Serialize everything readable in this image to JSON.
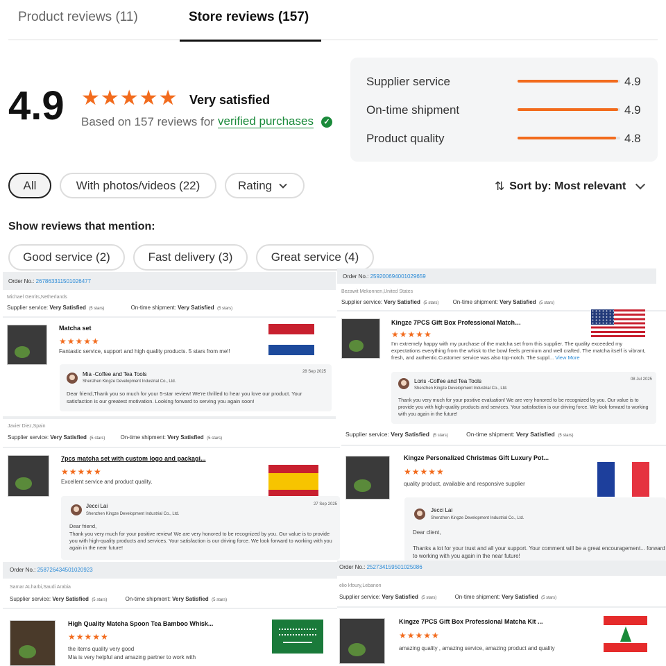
{
  "tabs": [
    {
      "label": "Product reviews (11)"
    },
    {
      "label": "Store reviews (157)"
    }
  ],
  "summary": {
    "score": "4.9",
    "stars": "★★★★★",
    "rating_text": "Very satisfied",
    "based_on": "Based on 157 reviews for",
    "verified_link": "verified purchases",
    "verified_icon": "✓"
  },
  "metrics": [
    {
      "label": "Supplier service",
      "value": "4.9",
      "fill": 0.98
    },
    {
      "label": "On-time shipment",
      "value": "4.9",
      "fill": 0.98
    },
    {
      "label": "Product quality",
      "value": "4.8",
      "fill": 0.96
    }
  ],
  "filters": {
    "all": "All",
    "photos": "With photos/videos (22)",
    "rating": "Rating",
    "sort": "Sort by: Most relevant"
  },
  "mentions": {
    "title": "Show reviews that mention:",
    "tags": [
      "Good service (2)",
      "Fast delivery (3)",
      "Great service (4)"
    ]
  },
  "reviews": [
    {
      "order_label": "Order No.:",
      "order_no": "267863311501026477",
      "reviewer": "Michael Gerrits,Netherlands",
      "supplier_label": "Supplier service:",
      "supplier_value": "Very Satisfied",
      "supplier_stars": "(5 stars)",
      "shipment_label": "On-time shipment:",
      "shipment_value": "Very Satisfied",
      "shipment_stars": "(5 stars)",
      "product": "Matcha set",
      "stars": "★★★★★",
      "text": "Fantastic service, support and high quality products. 5 stars from me!!",
      "reply_name": "Mia -Coffee and Tea Tools",
      "reply_company": "Shenzhen Kingze Development Industrial Co., Ltd.",
      "reply_date": "28 Sep 2025",
      "reply_text": "Dear friend,Thank you so much for your 5-star review! We're thrilled to hear you love our product. Your satisfaction is our greatest motivation. Looking forward to serving you again soon!"
    },
    {
      "order_label": "Order No.:",
      "order_no": "259200694001029659",
      "reviewer": "Bezawit Mekonnen,United States",
      "supplier_label": "Supplier service:",
      "supplier_value": "Very Satisfied",
      "supplier_stars": "(5 stars)",
      "shipment_label": "On-time shipment:",
      "shipment_value": "Very Satisfied",
      "shipment_stars": "(5 stars)",
      "product": "Kingze 7PCS Gift Box Professional Matcha Kit ...",
      "stars": "★★★★★",
      "text": "I'm extremely happy with my purchase of the matcha set from this supplier. The quality exceeded my expectations everything from the whisk to the bowl feels premium and well crafted. The matcha itself is vibrant, fresh, and authentic.Customer service was also top-notch. The suppl...",
      "view_more": "View More",
      "reply_name": "Loris -Coffee and Tea Tools",
      "reply_company": "Shenzhen Kingze Development Industrial Co., Ltd.",
      "reply_date": "08 Jul 2025",
      "reply_text": "Thank you very much for your positive evaluation! We are very honored to be recognized by you. Our value is to provide you with high-quality products and services. Your satisfaction is our driving force. We look forward to working with you again in the future!"
    },
    {
      "reviewer": "Javier Diez,Spain",
      "supplier_label": "Supplier service:",
      "supplier_value": "Very Satisfied",
      "supplier_stars": "(5 stars)",
      "shipment_label": "On-time shipment:",
      "shipment_value": "Very Satisfied",
      "shipment_stars": "(5 stars)",
      "product": "7pcs matcha set with custom logo and packagi...",
      "stars": "★★★★★",
      "text": "Excellent service and product quality.",
      "reply_name": "Jecci Lai",
      "reply_company": "Shenzhen Kingze Development Industrial Co., Ltd.",
      "reply_date": "27 Sep 2025",
      "reply_greeting": "Dear friend,",
      "reply_text": "Thank you very much for your positive review! We are very honored to be recognized by you. Our value is to provide you with high-quality products and services. Your satisfaction is our driving force. We look forward to working with you again in the near future!"
    },
    {
      "supplier_label": "Supplier service:",
      "supplier_value": "Very Satisfied",
      "supplier_stars": "(5 stars)",
      "shipment_label": "On-time shipment:",
      "shipment_value": "Very Satisfied",
      "shipment_stars": "(5 stars)",
      "product": "Kingze Personalized Christmas Gift Luxury Pot...",
      "stars": "★★★★★",
      "text": "quality product, available and responsive supplier",
      "reply_name": "Jecci Lai",
      "reply_company": "Shenzhen Kingze Development Industrial Co., Ltd.",
      "reply_greeting": "Dear client,",
      "reply_text": "Thanks a lot for your trust and all your support. Your comment will be a great encouragement... forward to working with you again in the near future!"
    },
    {
      "order_label": "Order No.:",
      "order_no": "258726434501020923",
      "reviewer": "Samar ALharbi,Saudi Arabia",
      "supplier_label": "Supplier service:",
      "supplier_value": "Very Satisfied",
      "supplier_stars": "(5 stars)",
      "shipment_label": "On-time shipment:",
      "shipment_value": "Very Satisfied",
      "shipment_stars": "(5 stars)",
      "product": "High Quality Matcha Spoon Tea Bamboo Whisk...",
      "stars": "★★★★★",
      "text": "the items quality very good",
      "text2": "Mia is very helpful and amazing partner to work with"
    },
    {
      "order_label": "Order No.:",
      "order_no": "252734159501025086",
      "reviewer": "elio kfoury,Lebanon",
      "supplier_label": "Supplier service:",
      "supplier_value": "Very Satisfied",
      "supplier_stars": "(5 stars)",
      "shipment_label": "On-time shipment:",
      "shipment_value": "Very Satisfied",
      "shipment_stars": "(5 stars)",
      "product": "Kingze 7PCS Gift Box Professional Matcha Kit ...",
      "stars": "★★★★★",
      "text": "amazing quality , amazing service, amazing product and quality"
    }
  ],
  "flags": [
    "netherlands-flag",
    "usa-flag",
    "spain-flag",
    "france-flag",
    "saudi-arabia-flag",
    "lebanon-flag"
  ],
  "colors": {
    "accent": "#f26b1d",
    "link": "#2a8ad6",
    "verified": "#1a8a3a"
  }
}
